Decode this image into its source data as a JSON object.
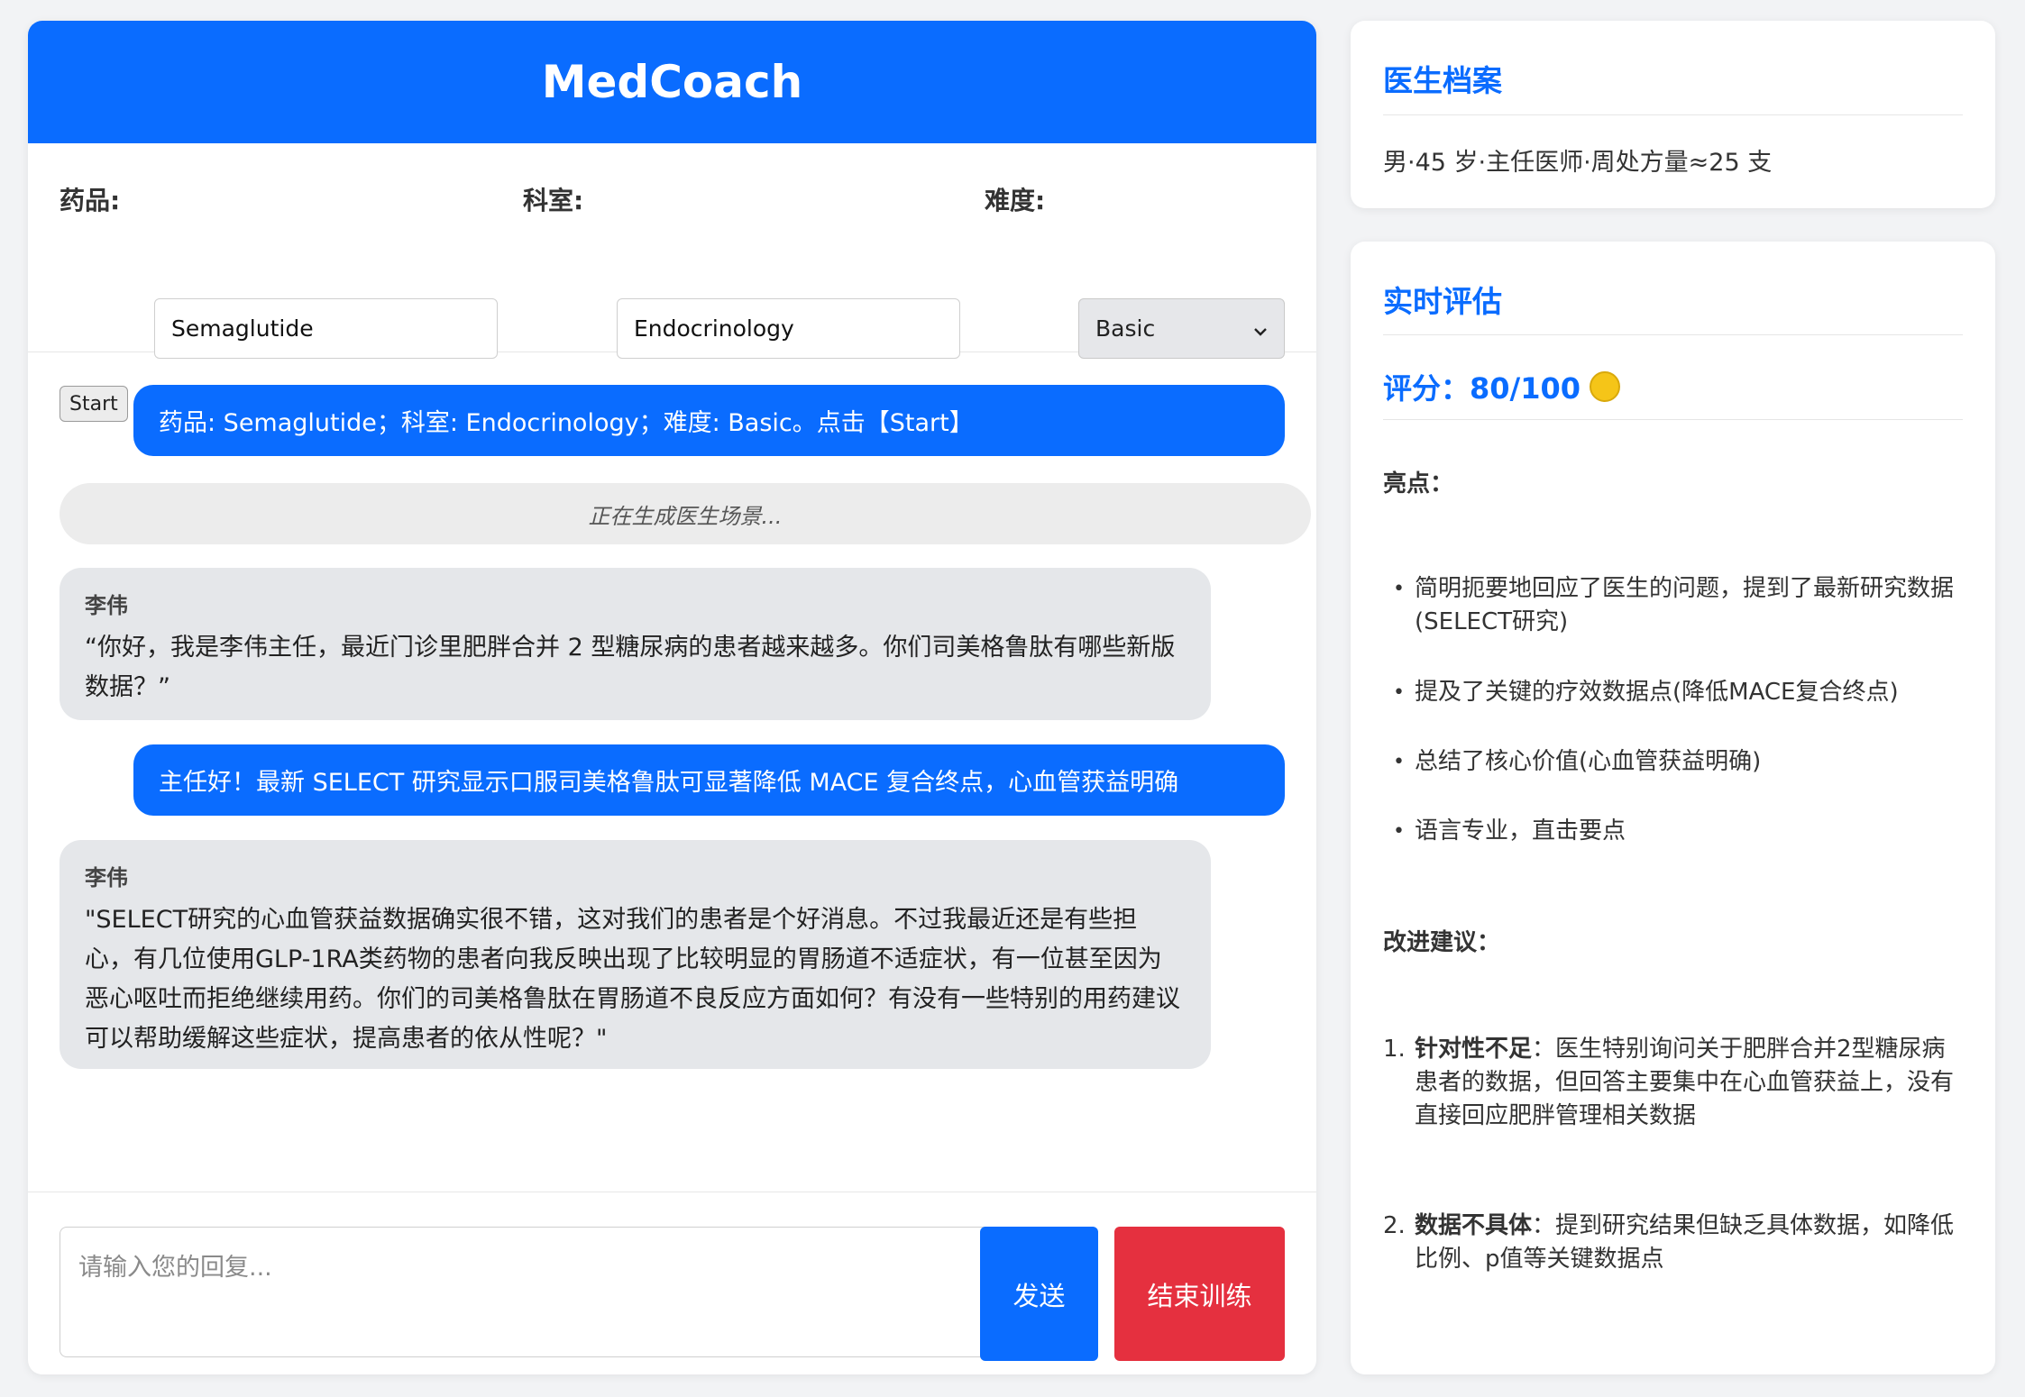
{
  "app": {
    "title": "MedCoach"
  },
  "controls": {
    "drug_label": "药品:",
    "drug_value": "Semaglutide",
    "dept_label": "科室:",
    "dept_value": "Endocrinology",
    "difficulty_label": "难度:",
    "difficulty_value": "Basic",
    "start_label": "Start"
  },
  "chat": {
    "messages": [
      {
        "role": "user",
        "text": "药品: Semaglutide；科室: Endocrinology；难度: Basic。点击【Start】"
      },
      {
        "role": "system",
        "text": "正在生成医生场景..."
      },
      {
        "role": "doctor",
        "name": "李伟",
        "text": "“你好，我是李伟主任，最近门诊里肥胖合并 2 型糖尿病的患者越来越多。你们司美格鲁肽有哪些新版数据？”"
      },
      {
        "role": "user",
        "text": "主任好！最新 SELECT 研究显示口服司美格鲁肽可显著降低 MACE 复合终点，心血管获益明确"
      },
      {
        "role": "doctor",
        "name": "李伟",
        "text": "\"SELECT研究的心血管获益数据确实很不错，这对我们的患者是个好消息。不过我最近还是有些担心，有几位使用GLP-1RA类药物的患者向我反映出现了比较明显的胃肠道不适症状，有一位甚至因为恶心呕吐而拒绝继续用药。你们的司美格鲁肽在胃肠道不良反应方面如何？有没有一些特别的用药建议可以帮助缓解这些症状，提高患者的依从性呢？\""
      }
    ]
  },
  "composer": {
    "placeholder": "请输入您的回复...",
    "send_label": "发送",
    "end_label": "结束训练"
  },
  "profile_card": {
    "title": "医生档案",
    "text": "男·45 岁·主任医师·周处方量≈25 支"
  },
  "eval_card": {
    "title": "实时评估",
    "score_text": "评分：80/100",
    "score_icon": "yellow-circle-emoji",
    "highlights_heading": "亮点：",
    "highlights": [
      "简明扼要地回应了医生的问题，提到了最新研究数据(SELECT研究)",
      "提及了关键的疗效数据点(降低MACE复合终点)",
      "总结了核心价值(心血管获益明确)",
      "语言专业，直击要点"
    ],
    "improvements_heading": "改进建议：",
    "improvements": [
      {
        "marker": "1.",
        "title": "针对性不足",
        "text": "：医生特别询问关于肥胖合并2型糖尿病患者的数据，但回答主要集中在心血管获益上，没有直接回应肥胖管理相关数据"
      },
      {
        "marker": "2.",
        "title": "数据不具体",
        "text": "：提到研究结果但缺乏具体数据，如降低比例、p值等关键数据点"
      }
    ]
  },
  "colors": {
    "primary": "#0a6cff",
    "danger": "#e5303f",
    "bot_bubble": "#e5e7ea",
    "page_bg": "#f2f3f5"
  }
}
